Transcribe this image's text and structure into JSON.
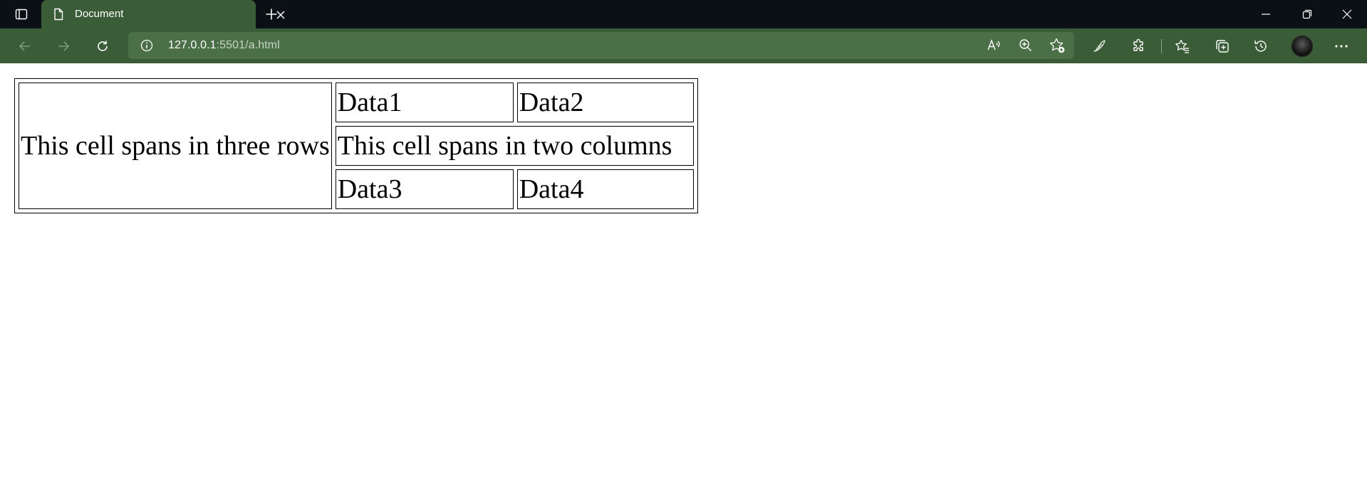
{
  "browser": {
    "tab": {
      "title": "Document"
    },
    "address": {
      "host": "127.0.0.1",
      "path": ":5501/a.html"
    }
  },
  "page": {
    "table": {
      "row_span_cell": "This cell spans in three rows",
      "col_span_cell": "This cell spans in two columns",
      "cells": [
        "Data1",
        "Data2",
        "Data3",
        "Data4"
      ]
    }
  },
  "colors": {
    "titlebar": "#0b1015",
    "toolbar": "#3a5d37",
    "addressbar": "#4b6f46"
  }
}
